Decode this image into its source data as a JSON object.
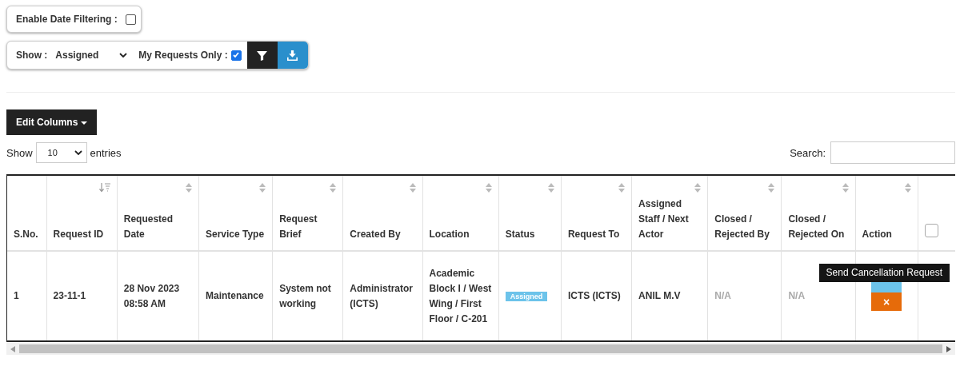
{
  "date_filter": {
    "label": "Enable Date Filtering :",
    "checked": false
  },
  "filter_bar": {
    "show_label": "Show :",
    "show_value": "Assigned",
    "my_requests": {
      "label": "My Requests Only :",
      "checked": true
    }
  },
  "edit_columns": "Edit Columns",
  "length": {
    "before": "Show",
    "value": "10",
    "after": "entries"
  },
  "search": {
    "label": "Search:"
  },
  "table": {
    "columns": [
      {
        "label": "S.No.",
        "sortable": false,
        "sorted": false
      },
      {
        "label": "Request ID",
        "sortable": true,
        "sorted": true
      },
      {
        "label": "Requested Date",
        "sortable": true,
        "sorted": false
      },
      {
        "label": "Service Type",
        "sortable": true,
        "sorted": false
      },
      {
        "label": "Request Brief",
        "sortable": true,
        "sorted": false
      },
      {
        "label": "Created By",
        "sortable": true,
        "sorted": false
      },
      {
        "label": "Location",
        "sortable": true,
        "sorted": false
      },
      {
        "label": "Status",
        "sortable": true,
        "sorted": false
      },
      {
        "label": "Request To",
        "sortable": true,
        "sorted": false
      },
      {
        "label": "Assigned Staff / Next Actor",
        "sortable": true,
        "sorted": false
      },
      {
        "label": "Closed / Rejected By",
        "sortable": true,
        "sorted": false
      },
      {
        "label": "Closed / Rejected On",
        "sortable": true,
        "sorted": false
      },
      {
        "label": "Action",
        "sortable": true,
        "sorted": false
      },
      {
        "kind": "checkbox",
        "checked": false,
        "sortable": false,
        "sorted": false
      }
    ],
    "rows": [
      {
        "cells": [
          {
            "kind": "text",
            "text": "1"
          },
          {
            "kind": "text",
            "text": "23-11-1"
          },
          {
            "kind": "text",
            "text": "28 Nov 2023 08:58 AM"
          },
          {
            "kind": "text",
            "text": "Maintenance"
          },
          {
            "kind": "text",
            "text": "System not working"
          },
          {
            "kind": "text",
            "text": "Administrator (ICTS)"
          },
          {
            "kind": "text",
            "text": "Academic Block I / West Wing / First Floor / C-201"
          },
          {
            "kind": "badge",
            "text": "Assigned"
          },
          {
            "kind": "text",
            "text": "ICTS (ICTS)"
          },
          {
            "kind": "text",
            "text": "ANIL M.V"
          },
          {
            "kind": "muted",
            "text": "N/A"
          },
          {
            "kind": "muted",
            "text": "N/A"
          },
          {
            "kind": "actions",
            "tooltip": "Send Cancellation Request",
            "cancel": "×"
          },
          {
            "kind": "empty"
          }
        ]
      }
    ]
  }
}
